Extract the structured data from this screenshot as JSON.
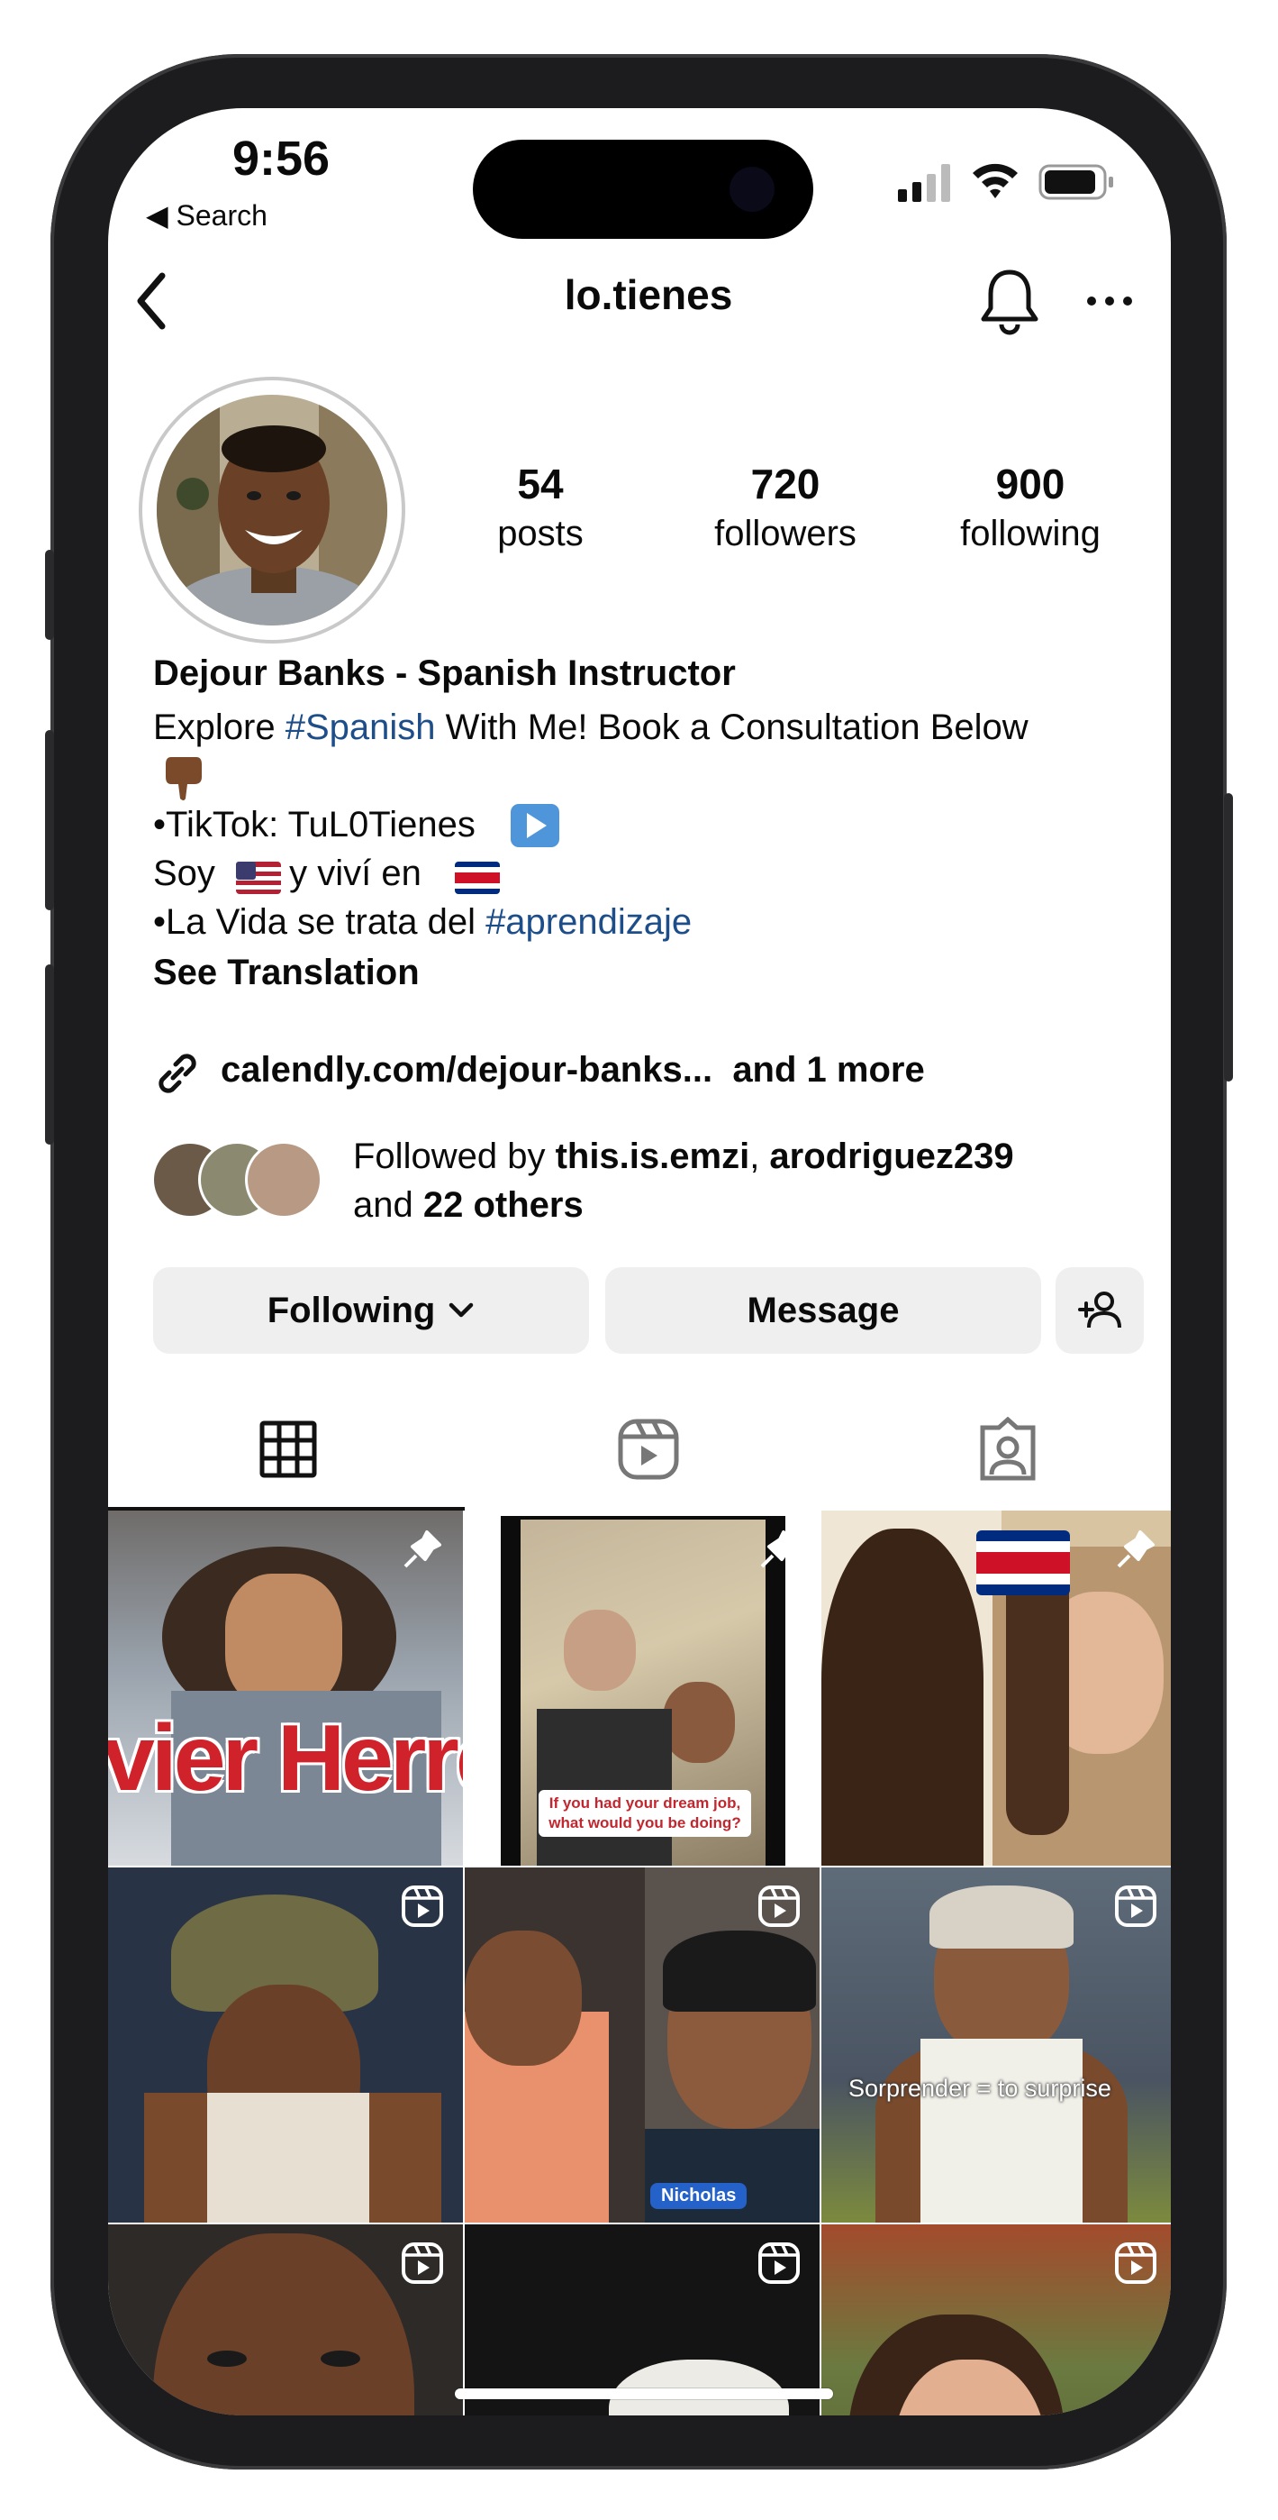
{
  "status_bar": {
    "time": "9:56",
    "back_label": "◀ Search"
  },
  "nav": {
    "username": "lo.tienes"
  },
  "stats": [
    {
      "value": "54",
      "label": "posts"
    },
    {
      "value": "720",
      "label": "followers"
    },
    {
      "value": "900",
      "label": "following"
    }
  ],
  "bio": {
    "name": "Dejour Banks - Spanish Instructor",
    "line1_a": "Explore ",
    "line1_tag": "#Spanish",
    "line1_b": " With Me! Book a Consultation Below",
    "line2": "•TikTok: TuL0Tienes",
    "line3_a": "Soy ",
    "line3_b": " y viví en ",
    "line4_a": "•La Vida se trata del ",
    "line4_tag": "#aprendizaje",
    "translate": "See Translation"
  },
  "link": {
    "url": "calendly.com/dejour-banks...",
    "more": "and 1 more"
  },
  "followed_by": {
    "prefix": "Followed by ",
    "user1": "this.is.emzi",
    "sep": ", ",
    "user2": "arodriguez239",
    "and": "and ",
    "others": "22 others"
  },
  "actions": {
    "following": "Following",
    "message": "Message"
  },
  "tabs": [
    "grid-icon",
    "reels-icon",
    "tagged-icon"
  ],
  "grid": {
    "tile1_caption": "vier Herre",
    "tile2_caption": "If you had your dream job, what would you be doing?",
    "tile5_caption": "Nicholas",
    "tile6_caption": "Sorprender = to surprise"
  },
  "colors": {
    "hashtag": "#1d4e89",
    "button_bg": "#efefef"
  }
}
